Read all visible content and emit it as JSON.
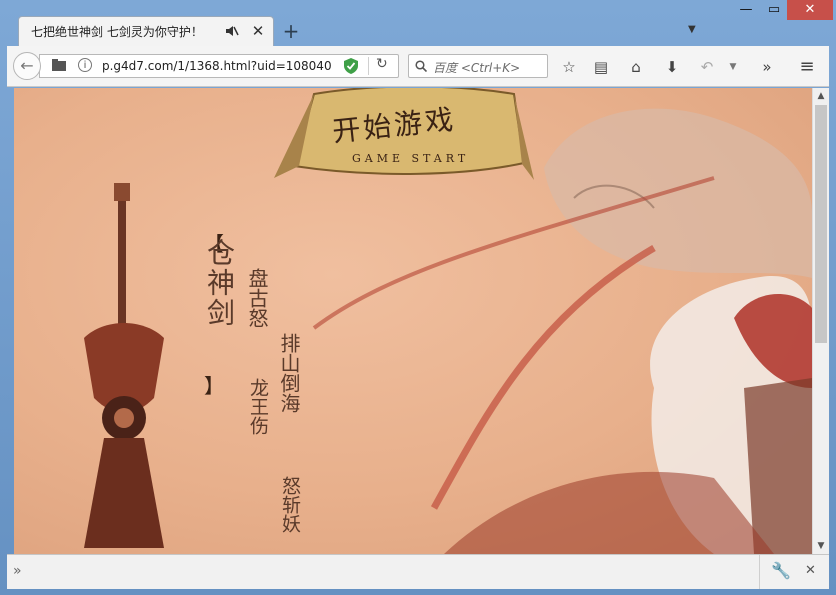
{
  "tab": {
    "title": "七把绝世神剑 七剑灵为你守护！"
  },
  "urlbar": {
    "url": "p.g4d7.com/1/1368.html?uid=108040"
  },
  "searchbar": {
    "placeholder": "百度 <Ctrl+K>"
  },
  "icons": {
    "back": "back-arrow-icon",
    "folder": "folder-icon",
    "info": "info-icon",
    "shield": "shield-icon",
    "reload": "reload-icon",
    "search": "search-icon",
    "bookmark": "star-icon",
    "reading": "reading-list-icon",
    "home": "home-icon",
    "download": "download-icon",
    "undo": "undo-icon",
    "more": "overflow-chevron-icon",
    "menu": "hamburger-menu-icon",
    "wrench": "wrench-icon"
  },
  "page": {
    "banner_title": "开始游戏",
    "banner_subtitle": "GAME START",
    "poem_title": "仓神剑",
    "poem_lines": [
      "盘古怒",
      "排山倒海",
      "龙王伤",
      "怒斩妖"
    ]
  },
  "colors": {
    "close_button": "#c7504a",
    "background": "#e8b08c"
  }
}
